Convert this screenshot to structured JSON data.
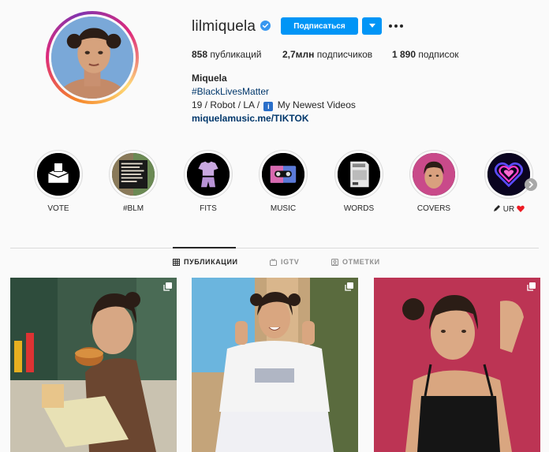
{
  "profile": {
    "username": "lilmiquela",
    "follow_label": "Подписаться",
    "stats": {
      "posts_count": "858",
      "posts_label": "публикаций",
      "followers_count": "2,7млн",
      "followers_label": "подписчиков",
      "following_count": "1 890",
      "following_label": "подписок"
    },
    "bio": {
      "name": "Miquela",
      "hashtag": "#BlackLivesMatter",
      "line3_prefix": "19 / Robot / LA / ",
      "line3_suffix": " My Newest Videos",
      "info_glyph": "i",
      "link": "miquelamusic.me/TIKTOK"
    }
  },
  "highlights": [
    {
      "label": "VOTE"
    },
    {
      "label": "#BLM"
    },
    {
      "label": "FITS"
    },
    {
      "label": "MUSIC"
    },
    {
      "label": "WORDS"
    },
    {
      "label": "COVERS"
    },
    {
      "label": "UR",
      "prefix_icon": "pen-icon",
      "suffix_icon": "heart-icon"
    }
  ],
  "tabs": [
    {
      "label": "ПУБЛИКАЦИИ",
      "active": true,
      "icon": "grid-icon"
    },
    {
      "label": "IGTV",
      "active": false,
      "icon": "igtv-icon"
    },
    {
      "label": "ОТМЕТКИ",
      "active": false,
      "icon": "tagged-icon"
    }
  ],
  "posts": [
    {
      "type": "carousel",
      "icon": "multiple-photos-icon"
    },
    {
      "type": "carousel",
      "icon": "multiple-photos-icon"
    },
    {
      "type": "carousel",
      "icon": "multiple-photos-icon"
    }
  ],
  "colors": {
    "primary_button": "#0095f6",
    "link": "#00376b",
    "text": "#262626",
    "muted": "#8e8e8e",
    "background": "#fafafa"
  }
}
